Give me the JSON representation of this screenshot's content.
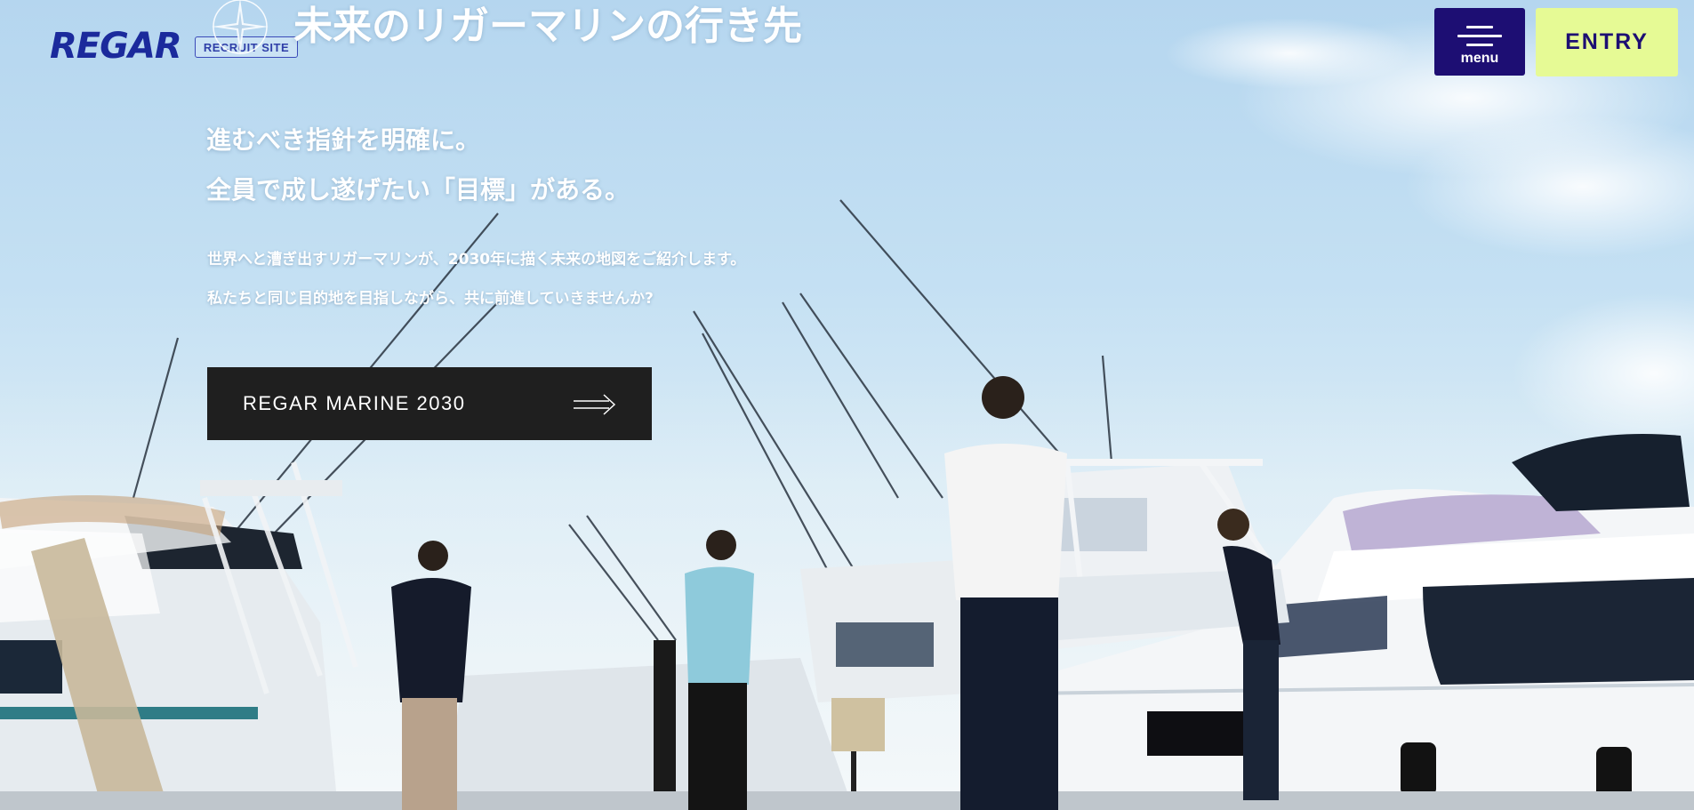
{
  "header": {
    "logo_text": "REGAR",
    "badge": "RECRUIT SITE",
    "title": "未来のリガーマリンの行き先",
    "menu_label": "menu",
    "entry_label": "ENTRY"
  },
  "hero": {
    "catch_line1": "進むべき指針を明確に。",
    "catch_line2": "全員で成し遂げたい「目標」がある。",
    "lead_line1": "世界へと漕ぎ出すリガーマリンが、2030年に描く未来の地図をご紹介します。",
    "lead_line2": "私たちと同じ目的地を目指しながら、共に前進していきませんか?",
    "cta_label": "REGAR MARINE 2030"
  },
  "colors": {
    "brand_navy": "#1d0e73",
    "entry_lime": "#e6fa95",
    "logo_blue": "#1b2a9c",
    "cta_dark": "#1f1f1f"
  },
  "icons": {
    "menu": "hamburger-icon",
    "cta": "arrow-right-icon",
    "decor": "compass-icon"
  }
}
